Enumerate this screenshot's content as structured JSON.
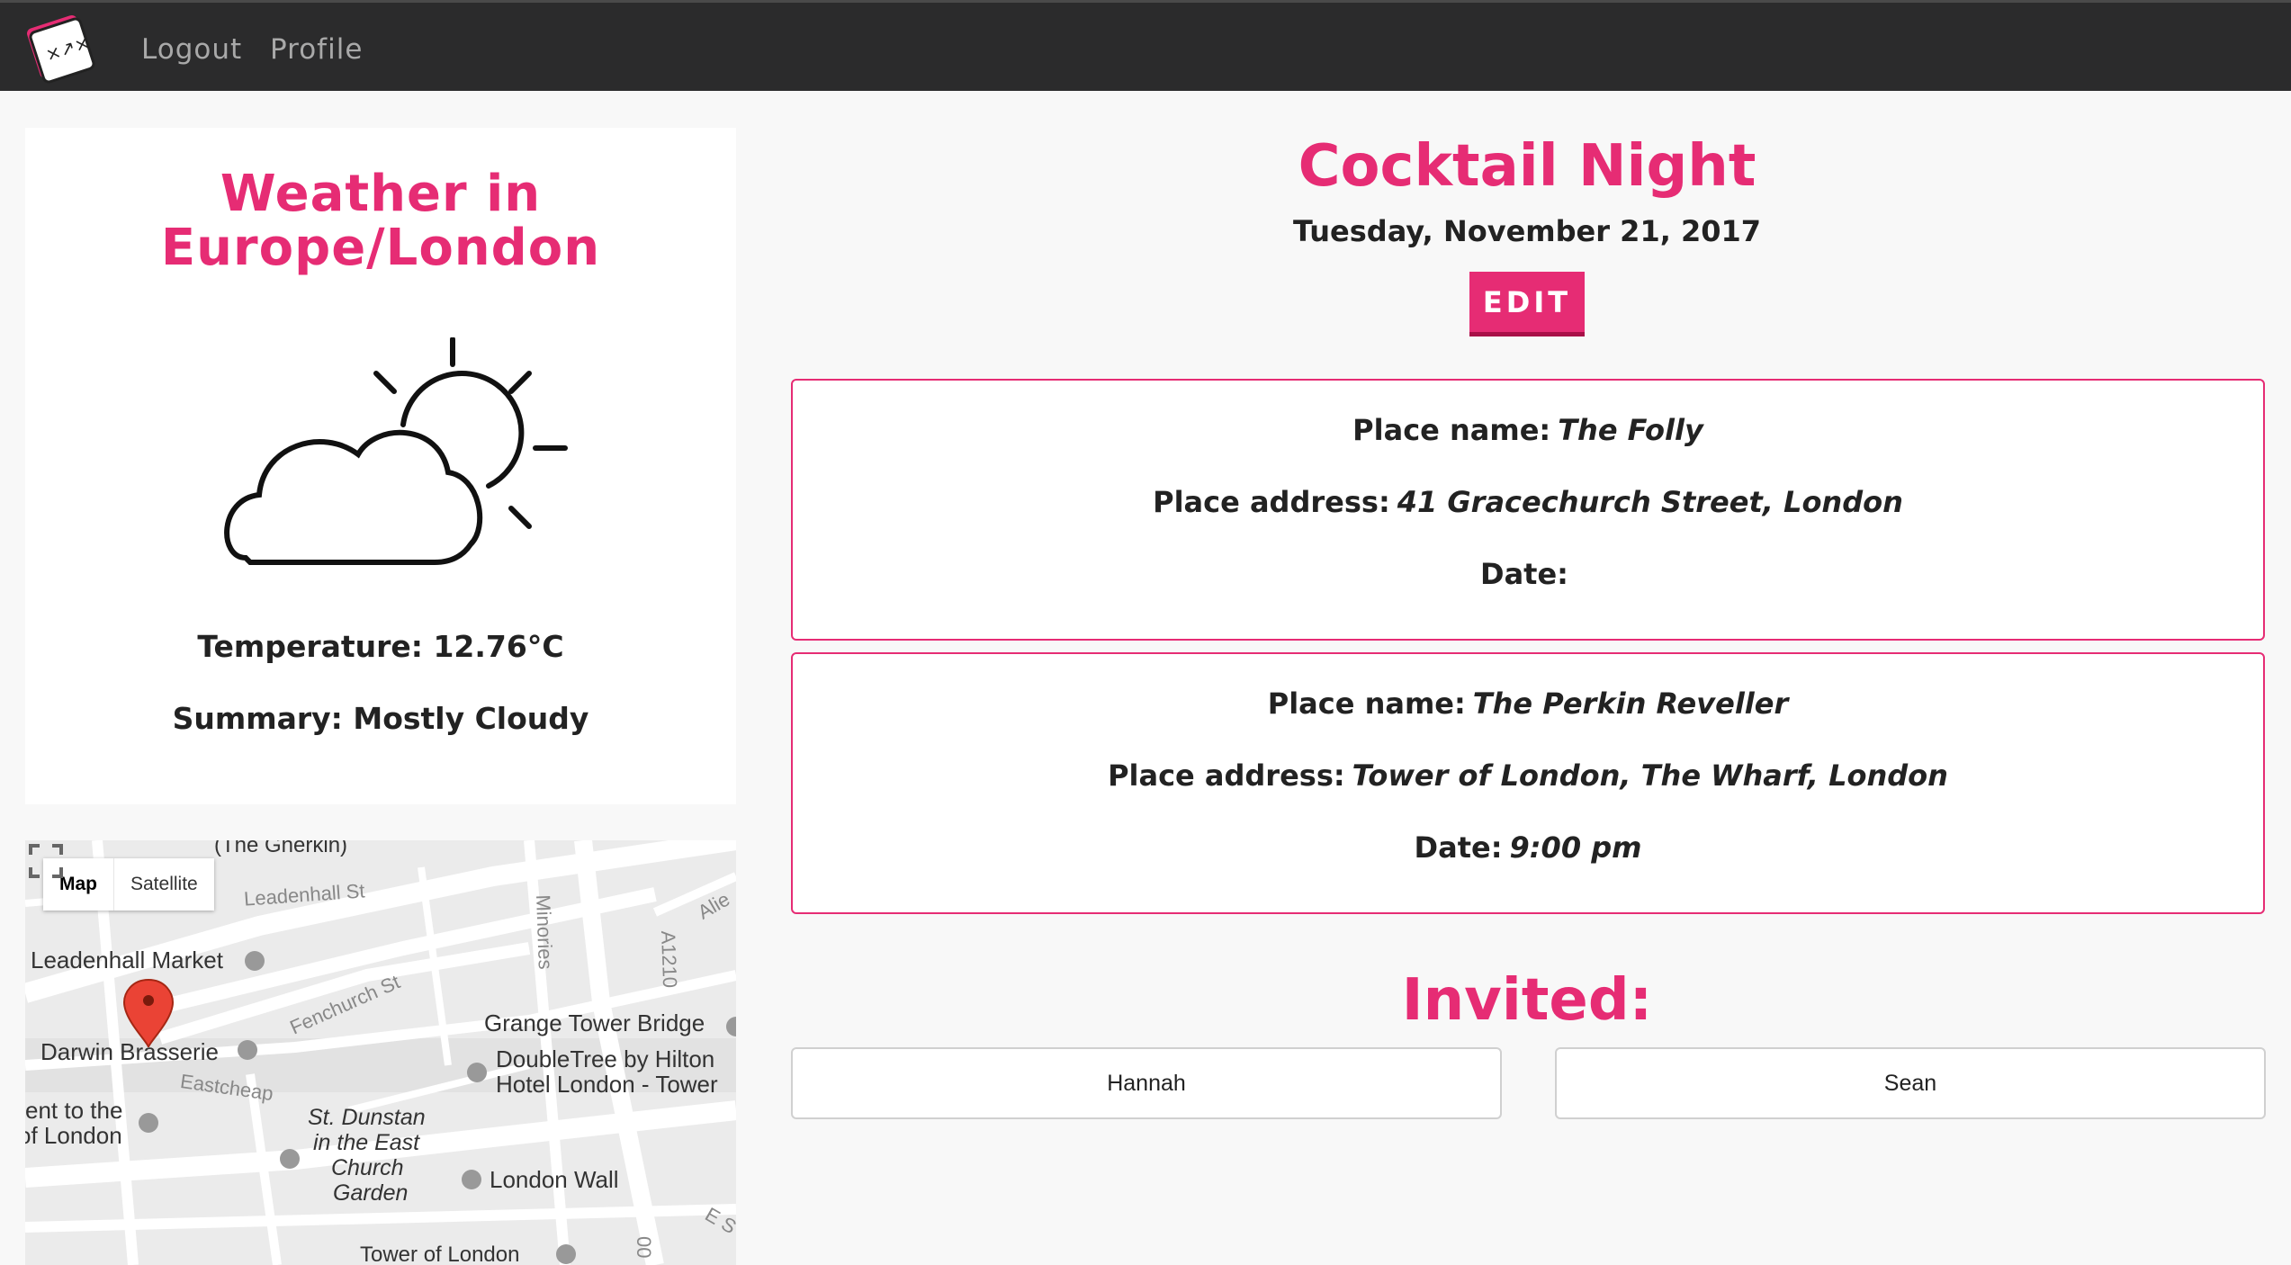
{
  "nav": {
    "logout_label": "Logout",
    "profile_label": "Profile"
  },
  "weather": {
    "title_line1": "Weather in",
    "title_line2": "Europe/London",
    "icon": "partly-cloudy-day-icon",
    "temperature_text": "Temperature: 12.76°C",
    "summary_text": "Summary: Mostly Cloudy"
  },
  "map": {
    "type_map_label": "Map",
    "type_satellite_label": "Satellite",
    "labels": {
      "gherkin": "(The Gherkin)",
      "leadenhall_st": "Leadenhall St",
      "leadenhall_market": "Leadenhall Market",
      "minories": "Minories",
      "a1210": "A1210",
      "alie": "Alie",
      "fenchurch_st": "Fenchurch St",
      "grange": "Grange Tower Bridge",
      "doubletree1": "DoubleTree by Hilton",
      "doubletree2": "Hotel London -  Tower",
      "darwin": "Darwin Brasserie",
      "eastcheap": "Eastcheap",
      "ent1": "ent to the",
      "ent2": "of London",
      "dunstan1": "St. Dunstan",
      "dunstan2": "in the East",
      "dunstan3": "Church",
      "dunstan4": "Garden",
      "london_wall": "London Wall",
      "tower": "Tower of London",
      "es": "E S",
      "oo": "00"
    }
  },
  "event": {
    "title": "Cocktail Night",
    "date": "Tuesday, November 21, 2017",
    "edit_label": "EDIT",
    "places": [
      {
        "name_label": "Place name:",
        "name": "The Folly",
        "address_label": "Place address:",
        "address": "41 Gracechurch Street, London",
        "date_label": "Date:",
        "date": ""
      },
      {
        "name_label": "Place name:",
        "name": "The Perkin Reveller",
        "address_label": "Place address:",
        "address": "Tower of London, The Wharf, London",
        "date_label": "Date:",
        "date": "9:00 pm"
      }
    ],
    "invited_title": "Invited:",
    "guests": [
      "Hannah",
      "Sean"
    ]
  },
  "colors": {
    "accent": "#e62c74",
    "nav_bg": "#2b2b2c",
    "page_bg": "#f8f8f8"
  }
}
